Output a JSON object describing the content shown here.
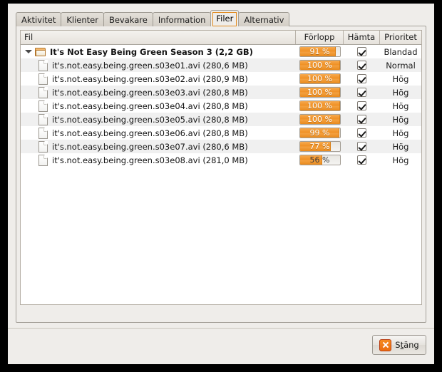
{
  "window": {
    "accent_color": "#ef8f22",
    "bg_color": "#efedea"
  },
  "tabs": [
    {
      "label": "Aktivitet",
      "active": false
    },
    {
      "label": "Klienter",
      "active": false
    },
    {
      "label": "Bevakare",
      "active": false
    },
    {
      "label": "Information",
      "active": false
    },
    {
      "label": "Filer",
      "active": true
    },
    {
      "label": "Alternativ",
      "active": false
    }
  ],
  "file_list": {
    "columns": [
      {
        "key": "file",
        "label": "Fil"
      },
      {
        "key": "progress",
        "label": "Förlopp"
      },
      {
        "key": "download",
        "label": "Hämta"
      },
      {
        "key": "priority",
        "label": "Prioritet"
      }
    ],
    "rows": [
      {
        "name": "It's Not Easy Being Green Season 3 (2,2 GB)",
        "icon": "folder-icon",
        "type": "folder",
        "expanded": true,
        "progress_label": "91 %",
        "progress_value": 91,
        "download": true,
        "priority": "Blandad"
      },
      {
        "name": "it's.not.easy.being.green.s03e01.avi (280,6 MB)",
        "icon": "file-icon",
        "type": "file",
        "progress_label": "100 %",
        "progress_value": 100,
        "download": true,
        "priority": "Normal"
      },
      {
        "name": "it's.not.easy.being.green.s03e02.avi (280,9 MB)",
        "icon": "file-icon",
        "type": "file",
        "progress_label": "100 %",
        "progress_value": 100,
        "download": true,
        "priority": "Hög"
      },
      {
        "name": "it's.not.easy.being.green.s03e03.avi (280,8 MB)",
        "icon": "file-icon",
        "type": "file",
        "progress_label": "100 %",
        "progress_value": 100,
        "download": true,
        "priority": "Hög"
      },
      {
        "name": "it's.not.easy.being.green.s03e04.avi (280,8 MB)",
        "icon": "file-icon",
        "type": "file",
        "progress_label": "100 %",
        "progress_value": 100,
        "download": true,
        "priority": "Hög"
      },
      {
        "name": "it's.not.easy.being.green.s03e05.avi (280,8 MB)",
        "icon": "file-icon",
        "type": "file",
        "progress_label": "100 %",
        "progress_value": 100,
        "download": true,
        "priority": "Hög"
      },
      {
        "name": "it's.not.easy.being.green.s03e06.avi (280,8 MB)",
        "icon": "file-icon",
        "type": "file",
        "progress_label": "99 %",
        "progress_value": 99,
        "download": true,
        "priority": "Hög"
      },
      {
        "name": "it's.not.easy.being.green.s03e07.avi (280,6 MB)",
        "icon": "file-icon",
        "type": "file",
        "progress_label": "77 %",
        "progress_value": 77,
        "download": true,
        "priority": "Hög"
      },
      {
        "name": "it's.not.easy.being.green.s03e08.avi (281,0 MB)",
        "icon": "file-icon",
        "type": "file",
        "progress_label": "56 %",
        "progress_value": 56,
        "download": true,
        "priority": "Hög"
      }
    ]
  },
  "footer": {
    "close_button": {
      "label": "Stäng",
      "mnemonic_index": 1,
      "icon": "close-x-icon"
    }
  }
}
